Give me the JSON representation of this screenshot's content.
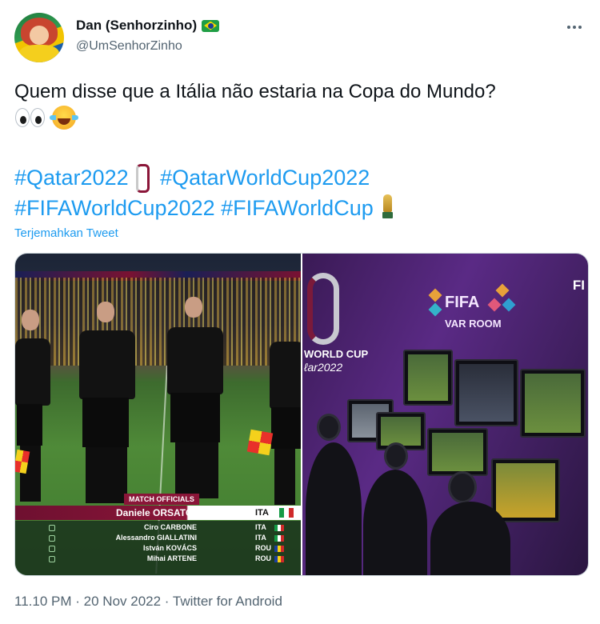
{
  "tweet": {
    "display_name": "Dan (Senhorzinho)",
    "handle": "@UmSenhorZinho",
    "text": "Quem disse que a Itália não estaria na Copa do Mundo?",
    "hashtags": [
      "#Qatar2022",
      "#QatarWorldCup2022",
      "#FIFAWorldCup2022",
      "#FIFAWorldCup"
    ],
    "translate_label": "Terjemahkan Tweet",
    "timestamp": "11.10 PM",
    "date": "20 Nov 2022",
    "source": "Twitter for Android",
    "separator": "·"
  },
  "icons": {
    "flag": "brazil-flag-icon",
    "more": "more-options-icon",
    "emoji1": "eyes-emoji-icon",
    "emoji2": "face-with-tears-of-joy-icon",
    "logo": "qatar-2022-emblem-icon",
    "trophy": "world-cup-trophy-icon"
  },
  "media": {
    "left": {
      "officials_label": "MATCH OFFICIALS",
      "referee": {
        "name": "Daniele ORSATO",
        "country": "ITA"
      },
      "officials": [
        {
          "name": "Ciro CARBONE",
          "country": "ITA"
        },
        {
          "name": "Alessandro GIALLATINI",
          "country": "ITA"
        },
        {
          "name": "István KOVÁCS",
          "country": "ROU"
        },
        {
          "name": "Mihai ARTENE",
          "country": "ROU"
        }
      ]
    },
    "right": {
      "worldcup_line1": "WORLD CUP",
      "worldcup_line2": "ℓar2022",
      "fifa": "FIFA",
      "var_room": "VAR ROOM",
      "partial": "FI"
    }
  },
  "colors": {
    "link": "#1d9bf0",
    "muted": "#536471",
    "text": "#0f1419",
    "qatar_maroon": "#8a1538"
  }
}
